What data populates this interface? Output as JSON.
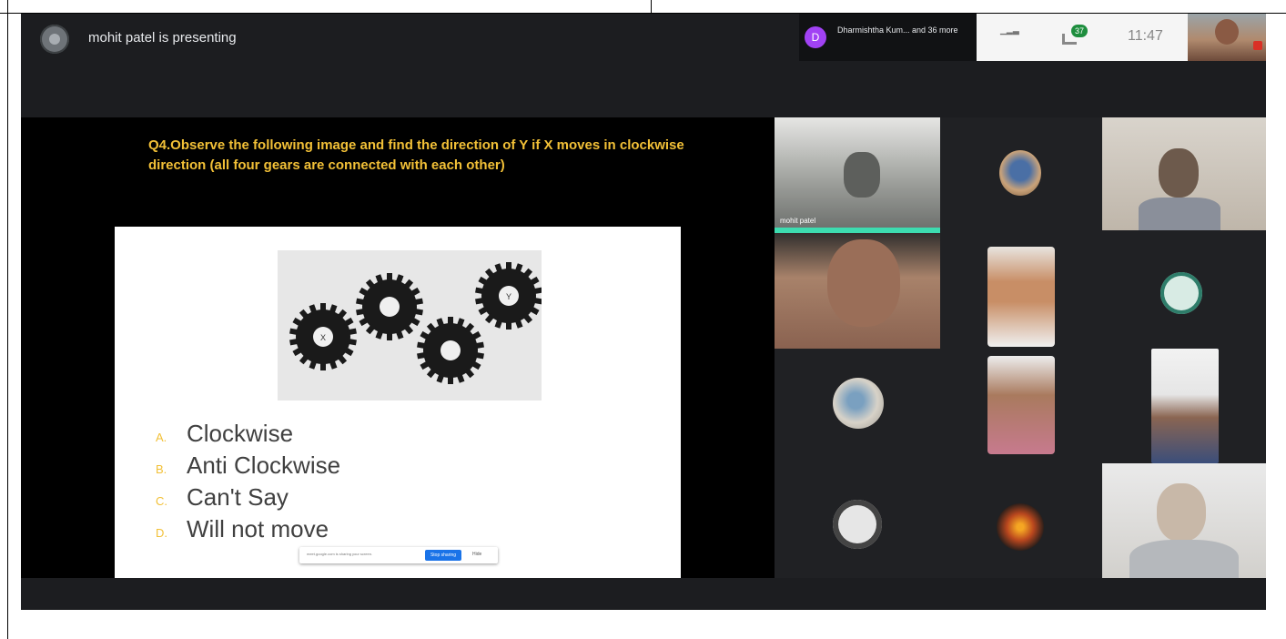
{
  "meeting": {
    "presenter_text": "mohit patel is presenting",
    "participants_label": "Dharmishtha Kum... and 36 more",
    "participants_initial": "D",
    "clock": "11:47",
    "badge_count": "37"
  },
  "slide": {
    "question": "Q4.Observe the following image and find the direction of Y if X moves in clockwise direction (all four gears are connected with each other)",
    "gear_labels": {
      "x": "X",
      "y": "Y"
    },
    "options": [
      {
        "letter": "A.",
        "text": "Clockwise"
      },
      {
        "letter": "B.",
        "text": "Anti Clockwise"
      },
      {
        "letter": "C.",
        "text": "Can't Say"
      },
      {
        "letter": "D.",
        "text": "Will not move"
      }
    ],
    "share_bar": {
      "text": "meet.google.com is sharing your screen.",
      "stop_button": "Stop sharing",
      "hide_button": "Hide"
    }
  },
  "tiles": {
    "presenter_name": "mohit patel"
  },
  "colors": {
    "accent_yellow": "#f2c037",
    "active_speaker": "#3ddcb0",
    "chip_purple": "#a142f4",
    "share_blue": "#1a73e8"
  }
}
